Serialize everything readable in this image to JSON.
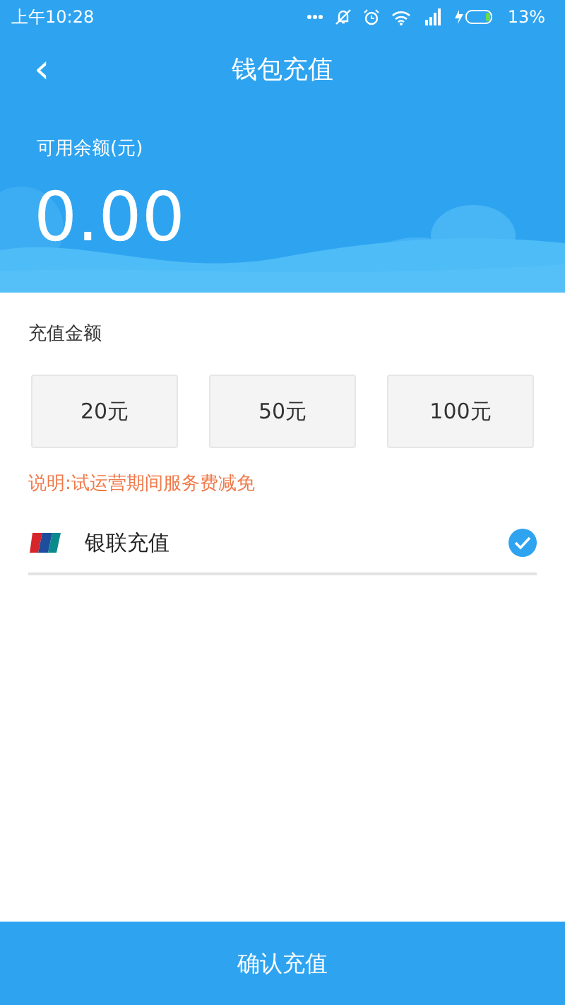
{
  "status_bar": {
    "time": "上午10:28",
    "battery_text": "13%"
  },
  "header": {
    "back": "‹",
    "title": "钱包充值"
  },
  "balance": {
    "label": "可用余额(元)",
    "amount": "0.00"
  },
  "recharge": {
    "label": "充值金额",
    "options": [
      {
        "label": "20元",
        "selected": false
      },
      {
        "label": "50元",
        "selected": false
      },
      {
        "label": "100元",
        "selected": false
      }
    ],
    "notice": "说明:试运营期间服务费减免"
  },
  "payment_methods": [
    {
      "label": "银联充值",
      "checked": true
    }
  ],
  "confirm_button": "确认充值"
}
